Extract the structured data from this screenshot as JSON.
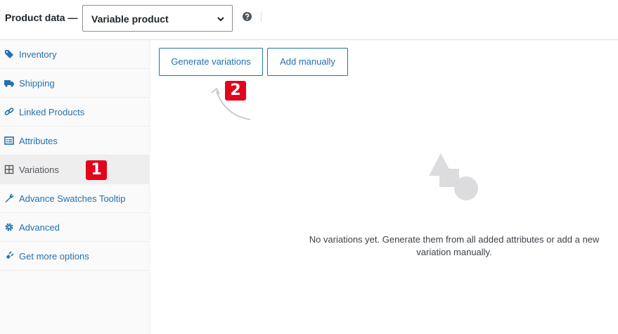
{
  "header": {
    "label": "Product data —",
    "product_type": {
      "selected": "Variable product"
    },
    "help_icon": "help-icon"
  },
  "sidebar": {
    "items": [
      {
        "label": "Inventory",
        "icon": "tag-icon"
      },
      {
        "label": "Shipping",
        "icon": "truck-icon"
      },
      {
        "label": "Linked Products",
        "icon": "link-icon"
      },
      {
        "label": "Attributes",
        "icon": "list-icon"
      },
      {
        "label": "Variations",
        "icon": "grid-icon",
        "active": true
      },
      {
        "label": "Advance Swatches Tooltip",
        "icon": "wrench-icon"
      },
      {
        "label": "Advanced",
        "icon": "gear-icon"
      },
      {
        "label": "Get more options",
        "icon": "plugin-icon"
      }
    ]
  },
  "annotations": {
    "step1": "1",
    "step2": "2"
  },
  "variations": {
    "generate_label": "Generate variations",
    "add_manually_label": "Add manually",
    "empty_line1": "No variations yet. Generate them from all added attributes or add a new",
    "empty_line2": "variation manually."
  },
  "colors": {
    "link": "#2271b1",
    "badge": "#e3051b",
    "active_tab_bg": "#eeeeee"
  }
}
